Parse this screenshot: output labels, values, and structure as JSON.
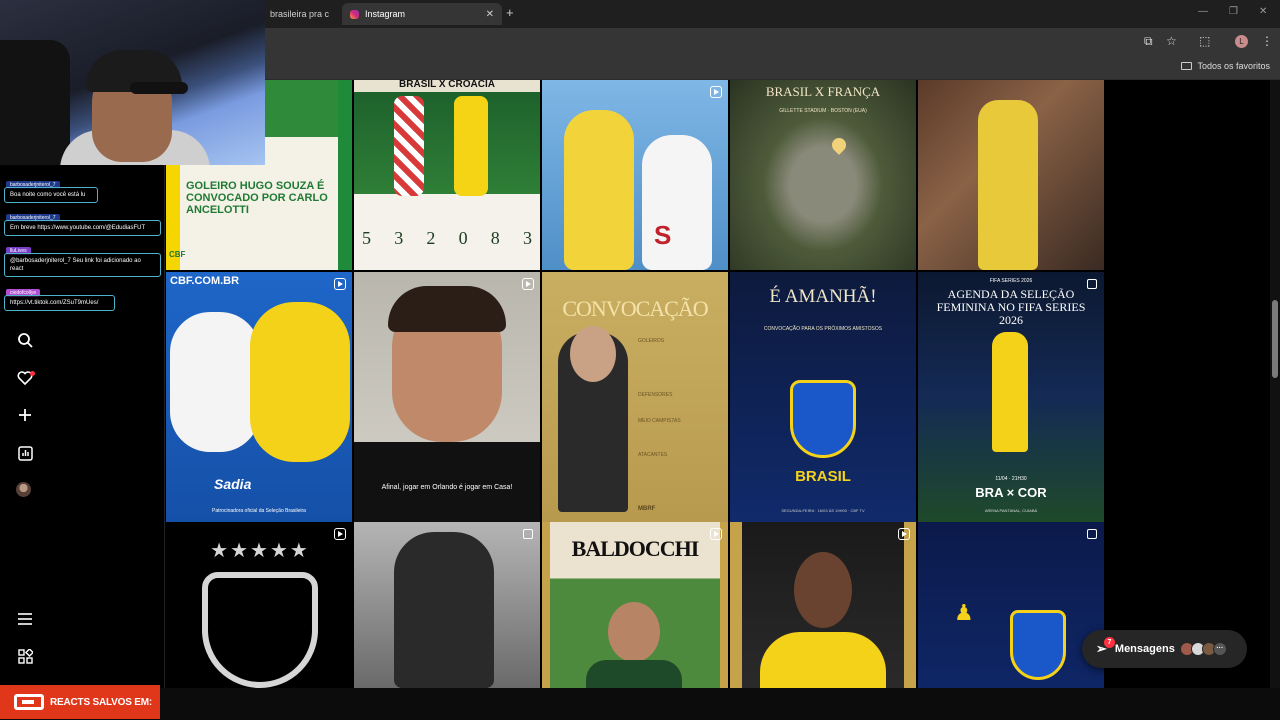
{
  "browser": {
    "tabs": [
      {
        "title": "brasileira pra c"
      },
      {
        "title": "Instagram"
      }
    ],
    "new_tab": "+",
    "bookmarks_label": "Todos os favoritos",
    "profile_initial": "L"
  },
  "chat": {
    "messages": [
      {
        "user": "barbosaderjniterol_7",
        "text": "Boa noite como você está lu"
      },
      {
        "user": "barbosaderjniterol_7",
        "text": "Em breve https://www.youtube.com/@EdudiasFUT"
      },
      {
        "user": "lluLives",
        "text": "@barbosaderjniterol_7 Seu link foi adicionado ao react"
      },
      {
        "user": "ciedofcollye",
        "text": "https://vt.tiktok.com/ZSuT9mUes/"
      }
    ]
  },
  "banner": {
    "label": "REACTS SALVOS EM:"
  },
  "messages_pill": {
    "label": "Mensagens",
    "badge": "7"
  },
  "posts": [
    {
      "title": "GOLEIRO HUGO SOUZA É CONVOCADO POR CARLO ANCELOTTI",
      "tag": "CBF"
    },
    {
      "title": "BRASIL X CROÁCIA",
      "stats": [
        "5",
        "3",
        "2",
        "0",
        "8",
        "3"
      ]
    },
    {
      "title": ""
    },
    {
      "title": "BRASIL X FRANÇA",
      "subtitle": "GILLETTE STADIUM · BOSTON (EUA)"
    },
    {
      "title": ""
    },
    {
      "header": "CBF.COM.BR",
      "sponsor": "Sadia",
      "caption": "Patrocinadora oficial da Seleção Brasileira"
    },
    {
      "caption": "Afinal, jogar em Orlando é jogar em Casa!"
    },
    {
      "title": "CONVOCAÇÃO",
      "sections": [
        "GOLEIROS",
        "DEFENSORES",
        "MEIO CAMPISTAS",
        "ATACANTES"
      ],
      "footer": "MBRF"
    },
    {
      "title": "É AMANHÃ!",
      "subtitle": "CONVOCAÇÃO PARA OS PRÓXIMOS AMISTOSOS",
      "brand": "BRASIL",
      "footer": "SEGUNDA-FEIRA · 16/03 ÀS 19H00 · CBF TV"
    },
    {
      "title": "AGENDA DA SELEÇÃO FEMININA NO FIFA SERIES 2026",
      "top": "FIFA SERIES 2026",
      "score": "BRA × COR",
      "date": "11/04 · 21H30",
      "venue": "ARENA PANTANAL, CUIABÁ"
    },
    {
      "title": ""
    },
    {
      "title": ""
    },
    {
      "title": "BALDOCCHI"
    },
    {
      "title": ""
    },
    {
      "title": ""
    }
  ]
}
